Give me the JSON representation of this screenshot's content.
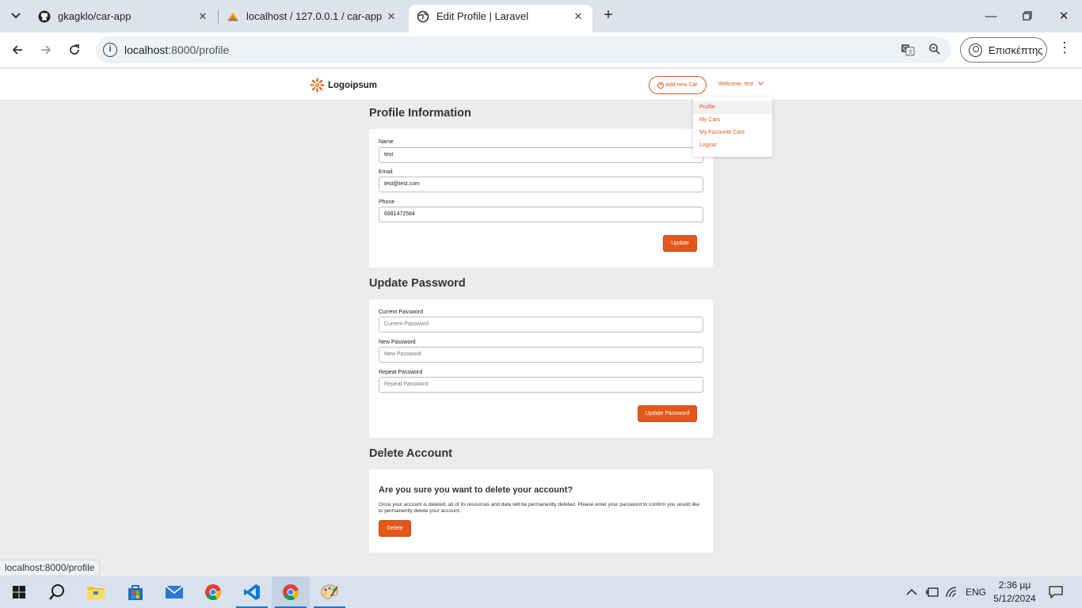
{
  "browser": {
    "tabs": [
      {
        "title": "gkagklo/car-app",
        "icon": "github-icon"
      },
      {
        "title": "localhost / 127.0.0.1 / car-app | ",
        "icon": "phpmyadmin-icon"
      },
      {
        "title": "Edit Profile | Laravel",
        "icon": "globe-icon",
        "active": true
      }
    ],
    "url_host": "localhost",
    "url_path": ":8000/profile",
    "profile_label": "Επισκέπτης",
    "status_url": "localhost:8000/profile"
  },
  "header": {
    "logo_text": "Logoipsum",
    "add_car_label": "Add new Car",
    "welcome_label": "Welcome, test",
    "menu": [
      "Profile",
      "My Cars",
      "My Favourite Cars",
      "Logout"
    ]
  },
  "profile": {
    "title": "Profile Information",
    "name_label": "Name",
    "name_value": "test",
    "email_label": "Email",
    "email_value": "test@test.com",
    "phone_label": "Phone",
    "phone_value": "6981472584",
    "update_label": "Update"
  },
  "password": {
    "title": "Update Password",
    "current_label": "Current Password",
    "current_placeholder": "Current Password",
    "new_label": "New Password",
    "new_placeholder": "New Password",
    "repeat_label": "Repeat Password",
    "repeat_placeholder": "Repeat Password",
    "submit_label": "Update Password"
  },
  "delete": {
    "title": "Delete Account",
    "question": "Are you sure you want to delete your account?",
    "description": "Once your account is deleted, all of its resources and data will be permanently deleted. Please enter your password to confirm you would like to permanently delete your account.",
    "button_label": "Delete"
  },
  "taskbar": {
    "language": "ENG",
    "time": "2:36 μμ",
    "date": "5/12/2024"
  },
  "colors": {
    "accent": "#e4571b",
    "page_bg": "#ececec"
  }
}
